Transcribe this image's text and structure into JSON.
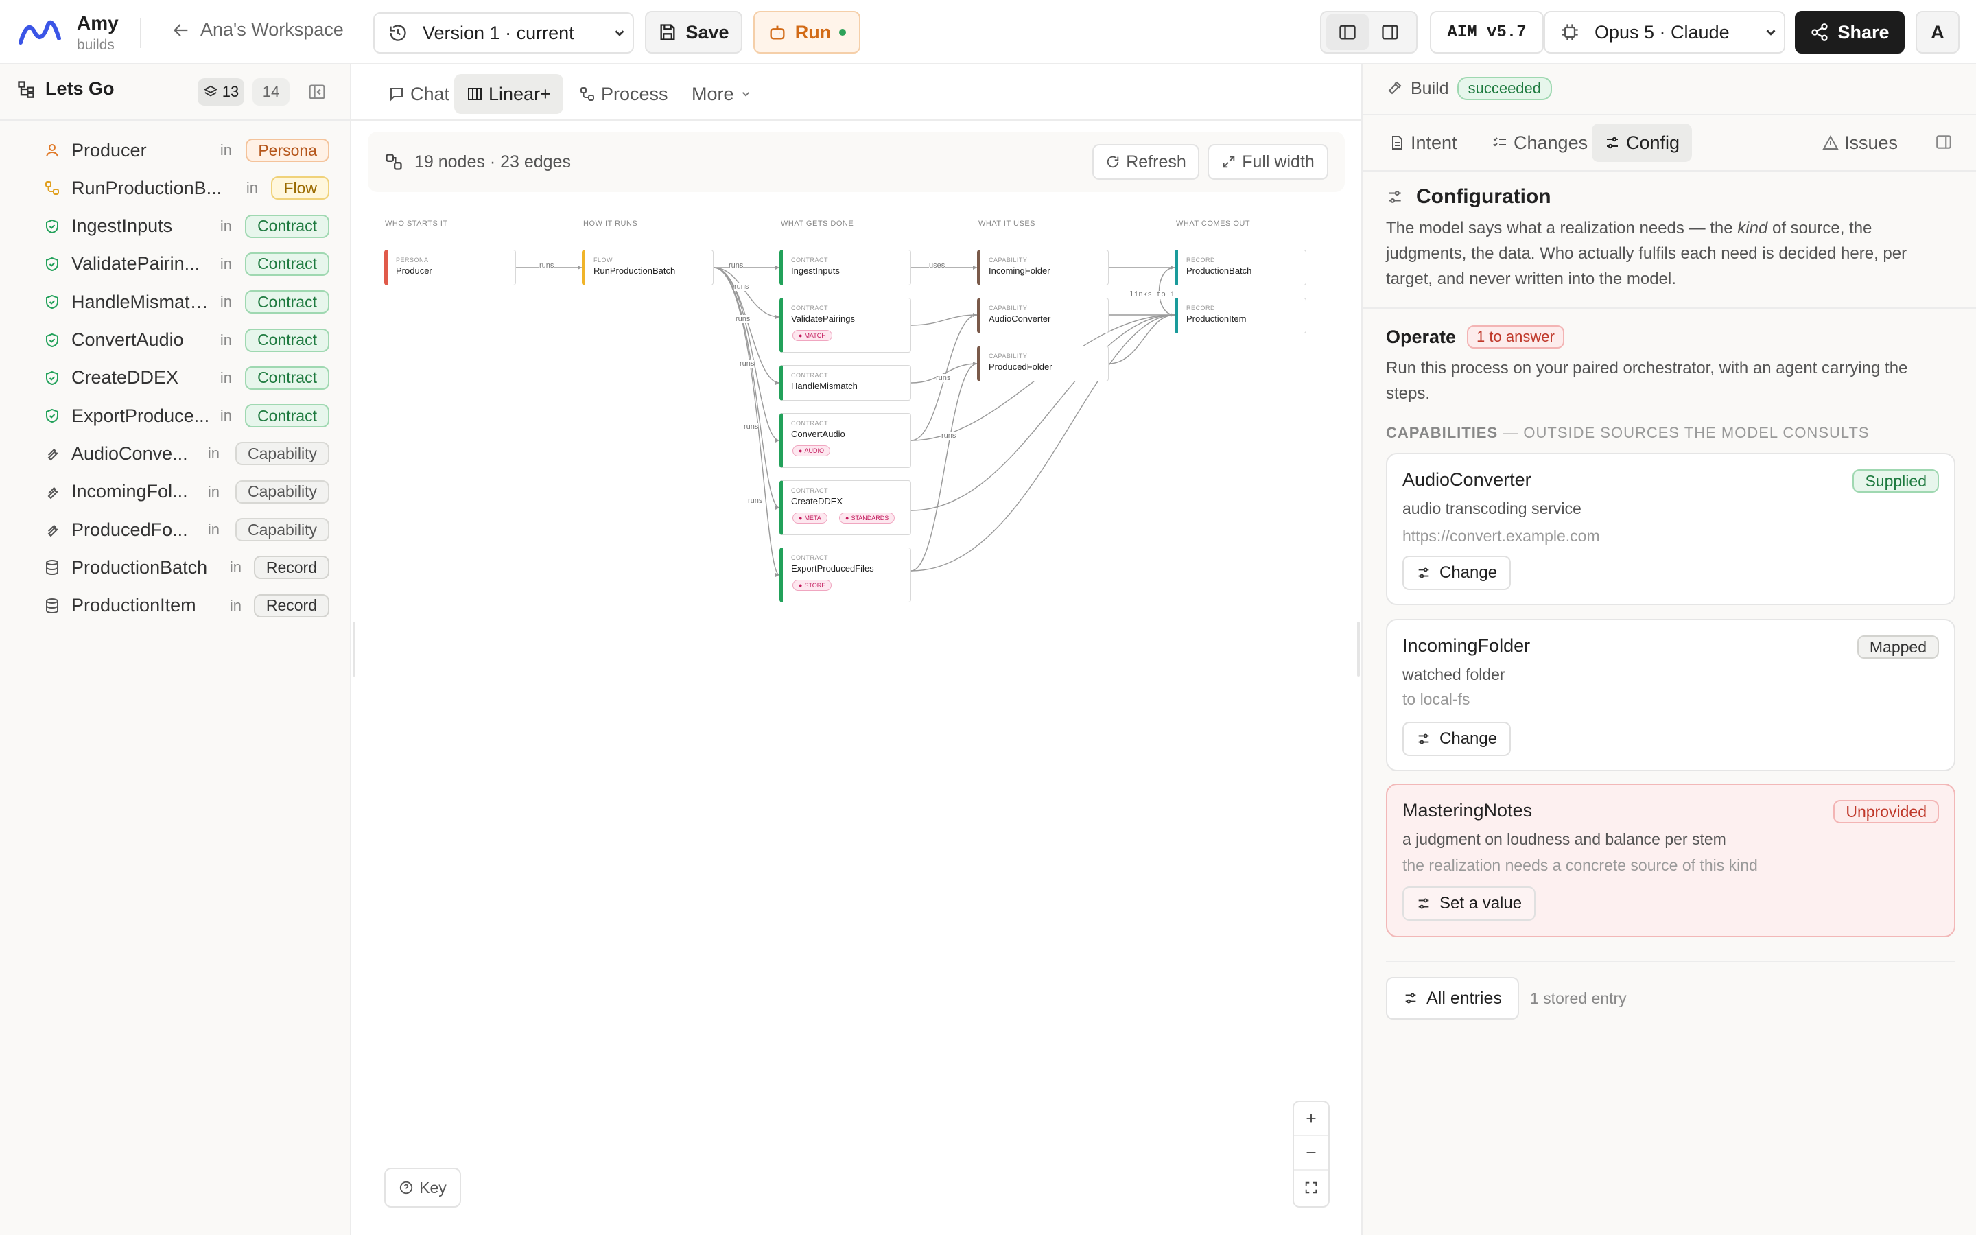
{
  "app": {
    "name": "Amy",
    "sub": "builds",
    "workspace": "Ana's Workspace"
  },
  "toolbar": {
    "version": "Version 1 · current",
    "save": "Save",
    "run": "Run",
    "aim": "AIM v5.7",
    "model": "Opus 5 · Claude",
    "share": "Share",
    "avatar": "A"
  },
  "sidebar": {
    "title": "Lets Go",
    "count_a": "13",
    "count_b": "14",
    "items": [
      {
        "name": "Producer",
        "in": "in",
        "kind": "Persona",
        "icon": "person-icon"
      },
      {
        "name": "RunProductionB...",
        "in": "in",
        "kind": "Flow",
        "icon": "flow-icon"
      },
      {
        "name": "IngestInputs",
        "in": "in",
        "kind": "Contract",
        "icon": "shield-icon"
      },
      {
        "name": "ValidatePairin...",
        "in": "in",
        "kind": "Contract",
        "icon": "shield-icon"
      },
      {
        "name": "HandleMismatc...",
        "in": "in",
        "kind": "Contract",
        "icon": "shield-icon"
      },
      {
        "name": "ConvertAudio",
        "in": "in",
        "kind": "Contract",
        "icon": "shield-icon"
      },
      {
        "name": "CreateDDEX",
        "in": "in",
        "kind": "Contract",
        "icon": "shield-icon"
      },
      {
        "name": "ExportProduce...",
        "in": "in",
        "kind": "Contract",
        "icon": "shield-icon"
      },
      {
        "name": "AudioConve...",
        "in": "in",
        "kind": "Capability",
        "icon": "wrench-icon"
      },
      {
        "name": "IncomingFol...",
        "in": "in",
        "kind": "Capability",
        "icon": "wrench-icon"
      },
      {
        "name": "ProducedFo...",
        "in": "in",
        "kind": "Capability",
        "icon": "wrench-icon"
      },
      {
        "name": "ProductionBatch",
        "in": "in",
        "kind": "Record",
        "icon": "database-icon"
      },
      {
        "name": "ProductionItem",
        "in": "in",
        "kind": "Record",
        "icon": "database-icon"
      }
    ]
  },
  "center": {
    "tabs": [
      "Chat",
      "Linear+",
      "Process",
      "More"
    ],
    "stats": "19 nodes · 23 edges",
    "refresh": "Refresh",
    "full_width": "Full width",
    "key": "Key",
    "columns": [
      "WHO STARTS IT",
      "HOW IT RUNS",
      "WHAT GETS DONE",
      "WHAT IT USES",
      "WHAT COMES OUT"
    ],
    "nodes": {
      "producer": {
        "kind": "PERSONA",
        "name": "Producer"
      },
      "run": {
        "kind": "FLOW",
        "name": "RunProductionBatch"
      },
      "ingest": {
        "kind": "CONTRACT",
        "name": "IngestInputs"
      },
      "validate": {
        "kind": "CONTRACT",
        "name": "ValidatePairings",
        "tag": "MATCH"
      },
      "handle": {
        "kind": "CONTRACT",
        "name": "HandleMismatch"
      },
      "convert": {
        "kind": "CONTRACT",
        "name": "ConvertAudio",
        "tag": "AUDIO"
      },
      "ddex": {
        "kind": "CONTRACT",
        "name": "CreateDDEX",
        "tag": "META",
        "tag2": "STANDARDS"
      },
      "export": {
        "kind": "CONTRACT",
        "name": "ExportProducedFiles",
        "tag": "STORE"
      },
      "incoming": {
        "kind": "CAPABILITY",
        "name": "IncomingFolder"
      },
      "audioconv": {
        "kind": "CAPABILITY",
        "name": "AudioConverter"
      },
      "produced": {
        "kind": "CAPABILITY",
        "name": "ProducedFolder"
      },
      "batch": {
        "kind": "RECORD",
        "name": "ProductionBatch"
      },
      "item": {
        "kind": "RECORD",
        "name": "ProductionItem"
      }
    },
    "edge_labels": {
      "runs": "runs",
      "uses": "uses",
      "links": "links to 1"
    }
  },
  "panel": {
    "build": "Build",
    "build_status": "succeeded",
    "tabs": [
      "Intent",
      "Changes",
      "Config",
      "Issues"
    ],
    "config_title": "Configuration",
    "config_desc_a": "The model says what a realization needs — the ",
    "config_desc_em": "kind",
    "config_desc_b": " of source, the judgments, the data. Who actually fulfils each need is decided here, per target, and never written into the model.",
    "operate": "Operate",
    "operate_badge": "1 to answer",
    "operate_desc": "Run this process on your paired orchestrator, with an agent carrying the steps.",
    "caps_label": "CAPABILITIES",
    "caps_sub": " — OUTSIDE SOURCES THE MODEL CONSULTS",
    "cards": [
      {
        "title": "AudioConverter",
        "badge": "Supplied",
        "line1": "audio transcoding service",
        "line2": "https://convert.example.com",
        "button": "Change"
      },
      {
        "title": "IncomingFolder",
        "badge": "Mapped",
        "line1": "watched folder",
        "line2": "to local-fs",
        "button": "Change"
      },
      {
        "title": "MasteringNotes",
        "badge": "Unprovided",
        "line1": "a judgment on loudness and balance per stem",
        "line2": "the realization needs a concrete source of this kind",
        "button": "Set a value"
      }
    ],
    "all_entries": "All entries",
    "stored": "1 stored entry"
  },
  "colors": {
    "persona": "#e05a4a",
    "flow": "#f0b429",
    "contract": "#22a15a",
    "capability": "#7a5a4a",
    "record": "#1a9b9b",
    "run": "#e07b2a"
  }
}
